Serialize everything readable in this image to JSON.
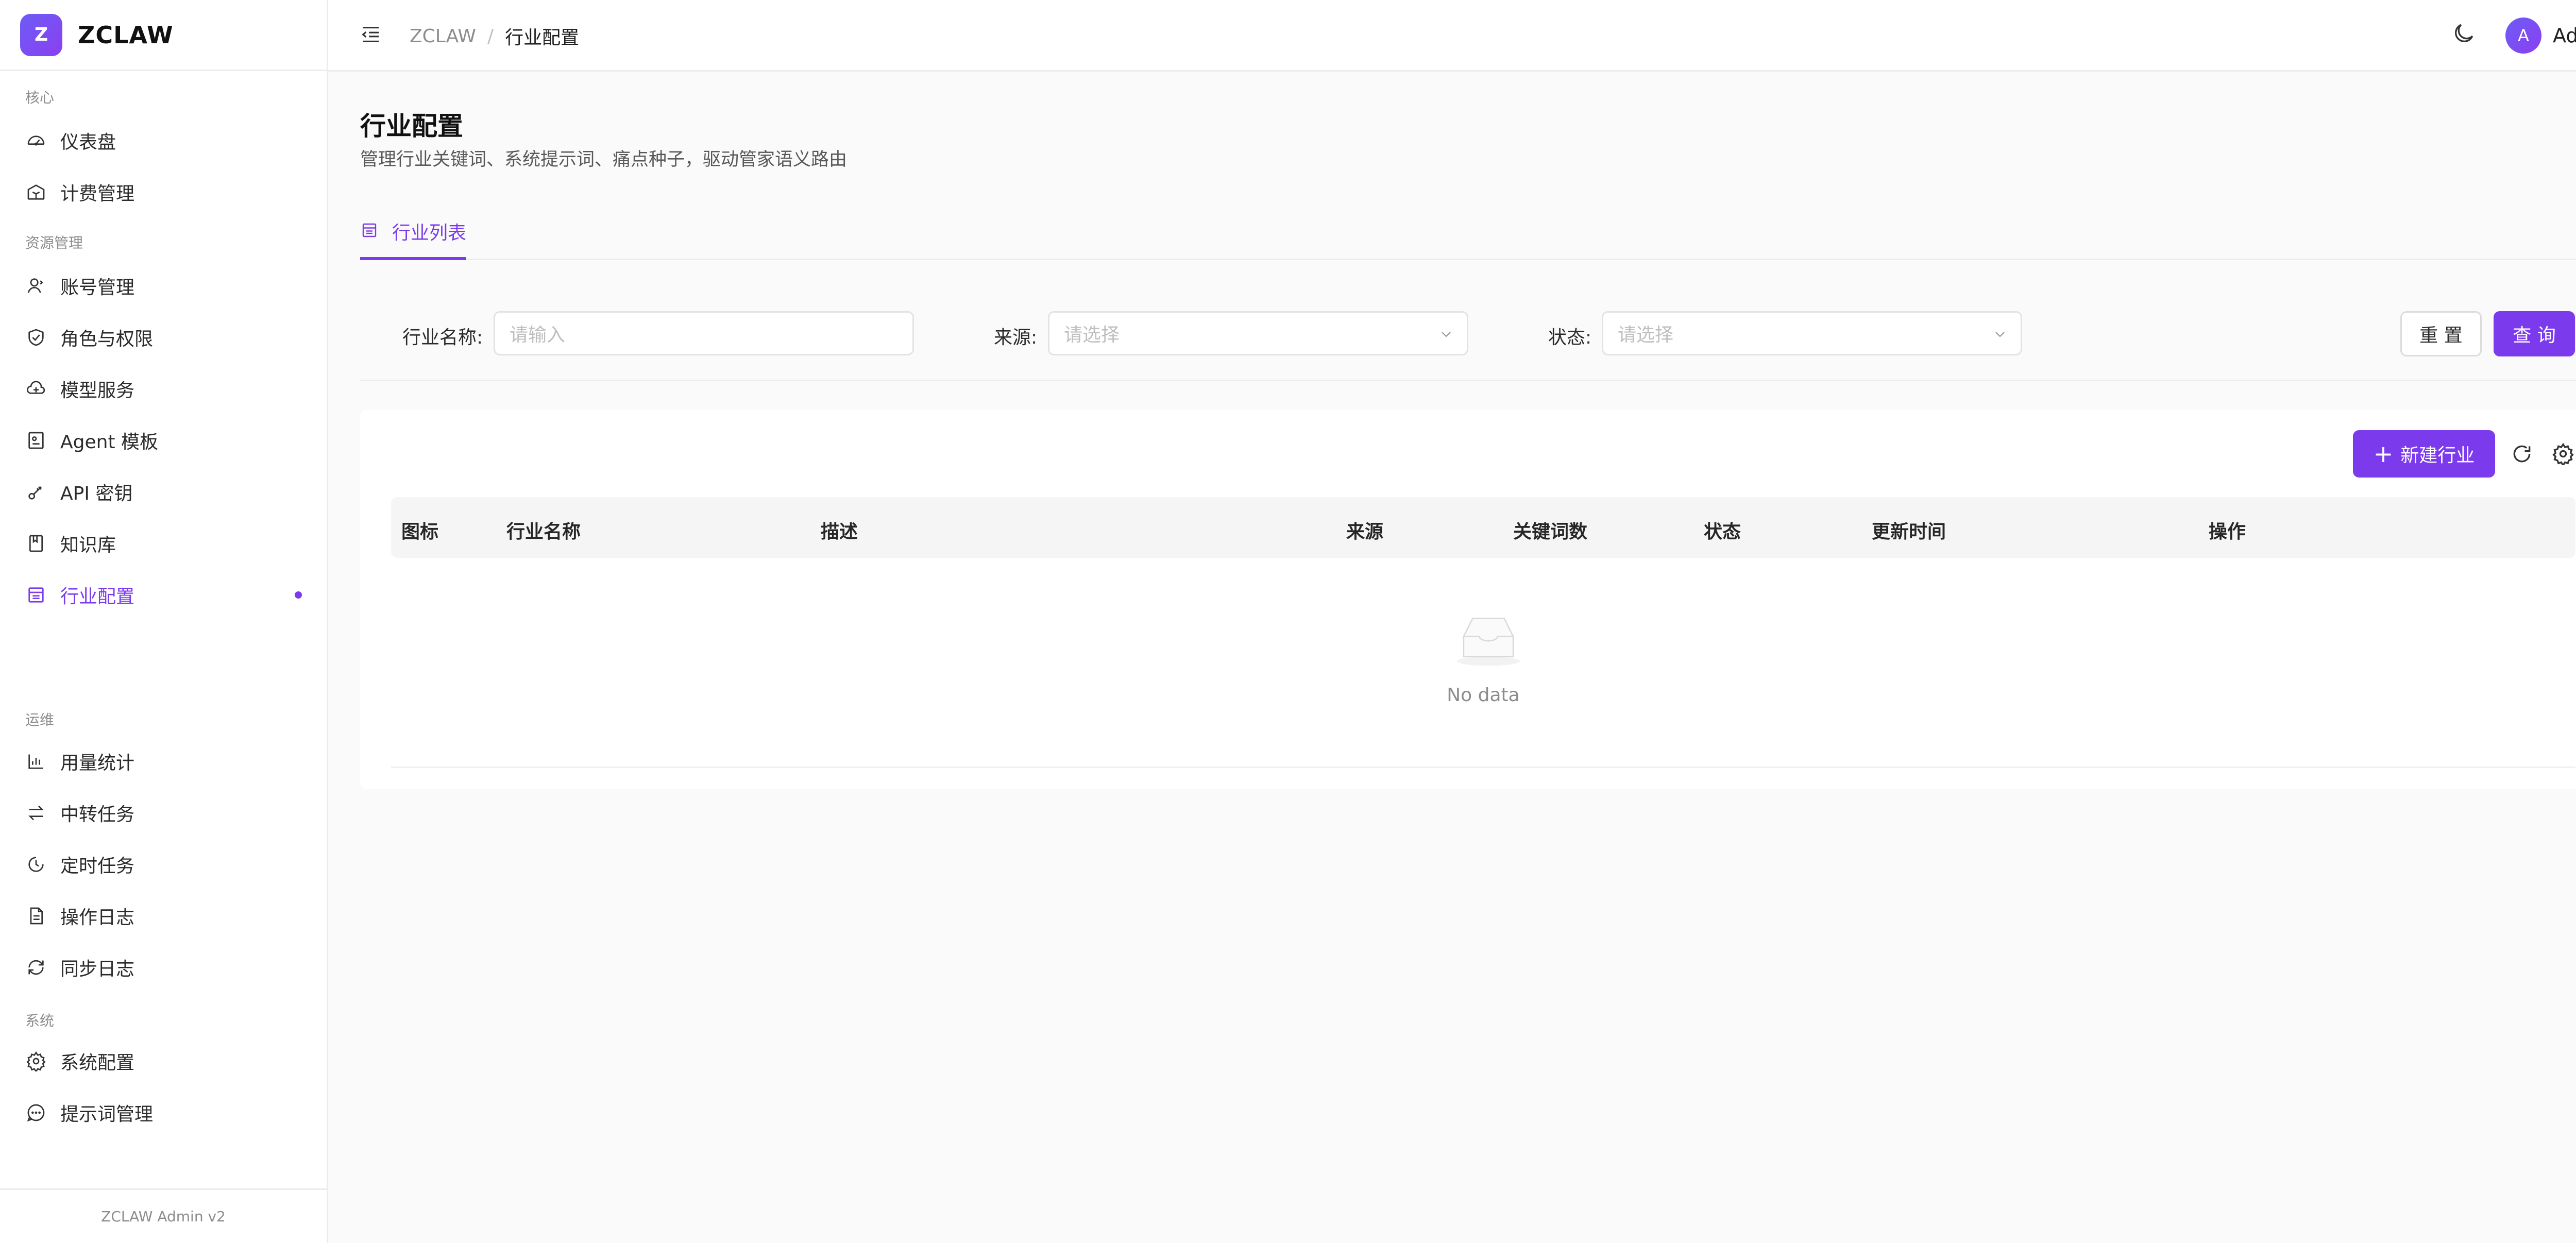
{
  "brand": {
    "logo_letter": "Z",
    "name": "ZCLAW"
  },
  "sidebar": {
    "sections": [
      {
        "label": "核心"
      },
      {
        "label": "资源管理"
      },
      {
        "label": "运维"
      },
      {
        "label": "系统"
      }
    ],
    "items": [
      {
        "label": "仪表盘",
        "icon": "dashboard-icon"
      },
      {
        "label": "计费管理",
        "icon": "billing-icon"
      },
      {
        "label": "账号管理",
        "icon": "users-icon"
      },
      {
        "label": "角色与权限",
        "icon": "shield-icon"
      },
      {
        "label": "模型服务",
        "icon": "cloud-icon"
      },
      {
        "label": "Agent 模板",
        "icon": "agent-template-icon"
      },
      {
        "label": "API 密钥",
        "icon": "key-icon"
      },
      {
        "label": "知识库",
        "icon": "book-icon"
      },
      {
        "label": "行业配置",
        "icon": "store-icon",
        "active": true
      },
      {
        "label": "用量统计",
        "icon": "bar-chart-icon"
      },
      {
        "label": "中转任务",
        "icon": "swap-icon"
      },
      {
        "label": "定时任务",
        "icon": "clock-icon"
      },
      {
        "label": "操作日志",
        "icon": "file-text-icon"
      },
      {
        "label": "同步日志",
        "icon": "sync-icon"
      },
      {
        "label": "系统配置",
        "icon": "gear-icon"
      },
      {
        "label": "提示词管理",
        "icon": "message-icon"
      }
    ],
    "footer": "ZCLAW Admin v2"
  },
  "header": {
    "breadcrumb_root": "ZCLAW",
    "breadcrumb_sep": "/",
    "breadcrumb_current": "行业配置",
    "user_initial": "A",
    "user_name": "Admin"
  },
  "page": {
    "title": "行业配置",
    "description": "管理行业关键词、系统提示词、痛点种子，驱动管家语义路由",
    "tabs": [
      {
        "label": "行业列表",
        "active": true
      }
    ]
  },
  "filter": {
    "name_label": "行业名称:",
    "name_placeholder": "请输入",
    "source_label": "来源:",
    "source_placeholder": "请选择",
    "status_label": "状态:",
    "status_placeholder": "请选择",
    "reset_label": "重 置",
    "query_label": "查 询"
  },
  "toolbar": {
    "new_label": "新建行业",
    "new_prefix": "+"
  },
  "table": {
    "columns": [
      "图标",
      "行业名称",
      "描述",
      "来源",
      "关键词数",
      "状态",
      "更新时间",
      "操作"
    ],
    "rows": [],
    "empty_text": "No data"
  },
  "colors": {
    "accent": "#7c3aed",
    "border": "#ececec",
    "background": "#fafafa"
  }
}
